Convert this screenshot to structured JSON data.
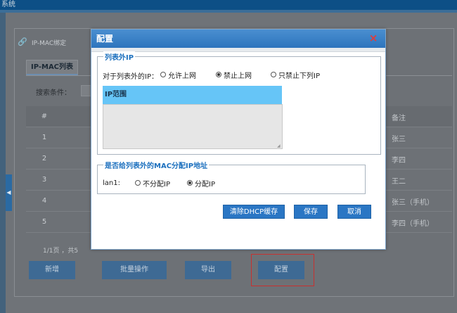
{
  "app": {
    "title_fragment": "系统"
  },
  "breadcrumb": {
    "label": "IP-MAC绑定"
  },
  "tabs": [
    {
      "label": "IP-MAC列表"
    }
  ],
  "search": {
    "label": "搜索条件："
  },
  "table": {
    "header_index": "#",
    "header_note": "备注",
    "rows": [
      {
        "index": "1",
        "note": "张三"
      },
      {
        "index": "2",
        "note": "李四"
      },
      {
        "index": "3",
        "note": "王二"
      },
      {
        "index": "4",
        "note": "张三（手机）"
      },
      {
        "index": "5",
        "note": "李四（手机）"
      }
    ]
  },
  "pager": {
    "text": "1/1页 ，共5"
  },
  "bottom_buttons": {
    "add": "新增",
    "batch": "批量操作",
    "export": "导出",
    "config": "配置"
  },
  "modal": {
    "title": "配置",
    "close_glyph": "×",
    "outside_group": {
      "legend": "列表外IP",
      "prompt": "对于列表外的IP：",
      "options": [
        {
          "label": "允许上网",
          "selected": false
        },
        {
          "label": "禁止上网",
          "selected": true
        },
        {
          "label": "只禁止下列IP",
          "selected": false
        }
      ],
      "ip_range_header": "IP范围",
      "ip_range_value": ""
    },
    "assign_group": {
      "legend": "是否给列表外的MAC分配IP地址",
      "interface_label": "lan1:",
      "options": [
        {
          "label": "不分配IP",
          "selected": false
        },
        {
          "label": "分配IP",
          "selected": true
        }
      ]
    },
    "buttons": {
      "clear_dhcp": "清除DHCP缓存",
      "save": "保存",
      "cancel": "取消"
    }
  },
  "colors": {
    "modal_header": "#2d74bd",
    "accent_blue": "#1c70be",
    "ip_header": "#66c5f7",
    "highlight_border": "#c8302f"
  }
}
